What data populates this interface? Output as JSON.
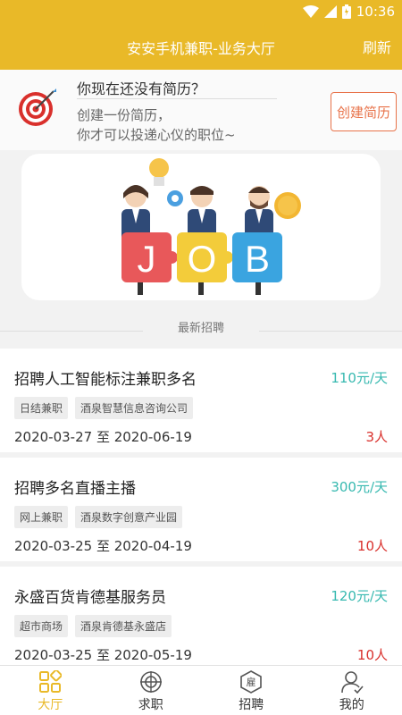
{
  "status_bar": {
    "time": "10:36"
  },
  "app_bar": {
    "title": "安安手机兼职-业务大厅",
    "refresh_label": "刷新"
  },
  "resume_prompt": {
    "question": "你现在还没有简历？",
    "line1": "创建一份简历，",
    "line2": "你才可以投递心仪的职位~",
    "create_button": "创建简历"
  },
  "banner": {
    "letters": [
      "J",
      "O",
      "B"
    ]
  },
  "section": {
    "title": "最新招聘"
  },
  "jobs": [
    {
      "title": "招聘人工智能标注兼职多名",
      "salary": "110元/天",
      "tags": [
        "日结兼职",
        "酒泉智慧信息咨询公司"
      ],
      "dates": "2020-03-27 至 2020-06-19",
      "count": "3人"
    },
    {
      "title": "招聘多名直播主播",
      "salary": "300元/天",
      "tags": [
        "网上兼职",
        "酒泉数字创意产业园"
      ],
      "dates": "2020-03-25 至 2020-04-19",
      "count": "10人"
    },
    {
      "title": "永盛百货肯德基服务员",
      "salary": "120元/天",
      "tags": [
        "超市商场",
        "酒泉肯德基永盛店"
      ],
      "dates": "2020-03-25 至 2020-05-19",
      "count": "10人"
    }
  ],
  "bottom_nav": [
    {
      "label": "大厅",
      "icon": "hall-grid-icon",
      "active": true
    },
    {
      "label": "求职",
      "icon": "target-circle-icon",
      "active": false
    },
    {
      "label": "招聘",
      "icon": "hire-badge-icon",
      "active": false
    },
    {
      "label": "我的",
      "icon": "user-check-icon",
      "active": false
    }
  ],
  "colors": {
    "accent": "#e9b928",
    "salary": "#37b9b0",
    "count": "#d9302c",
    "create_button": "#e8734a"
  }
}
